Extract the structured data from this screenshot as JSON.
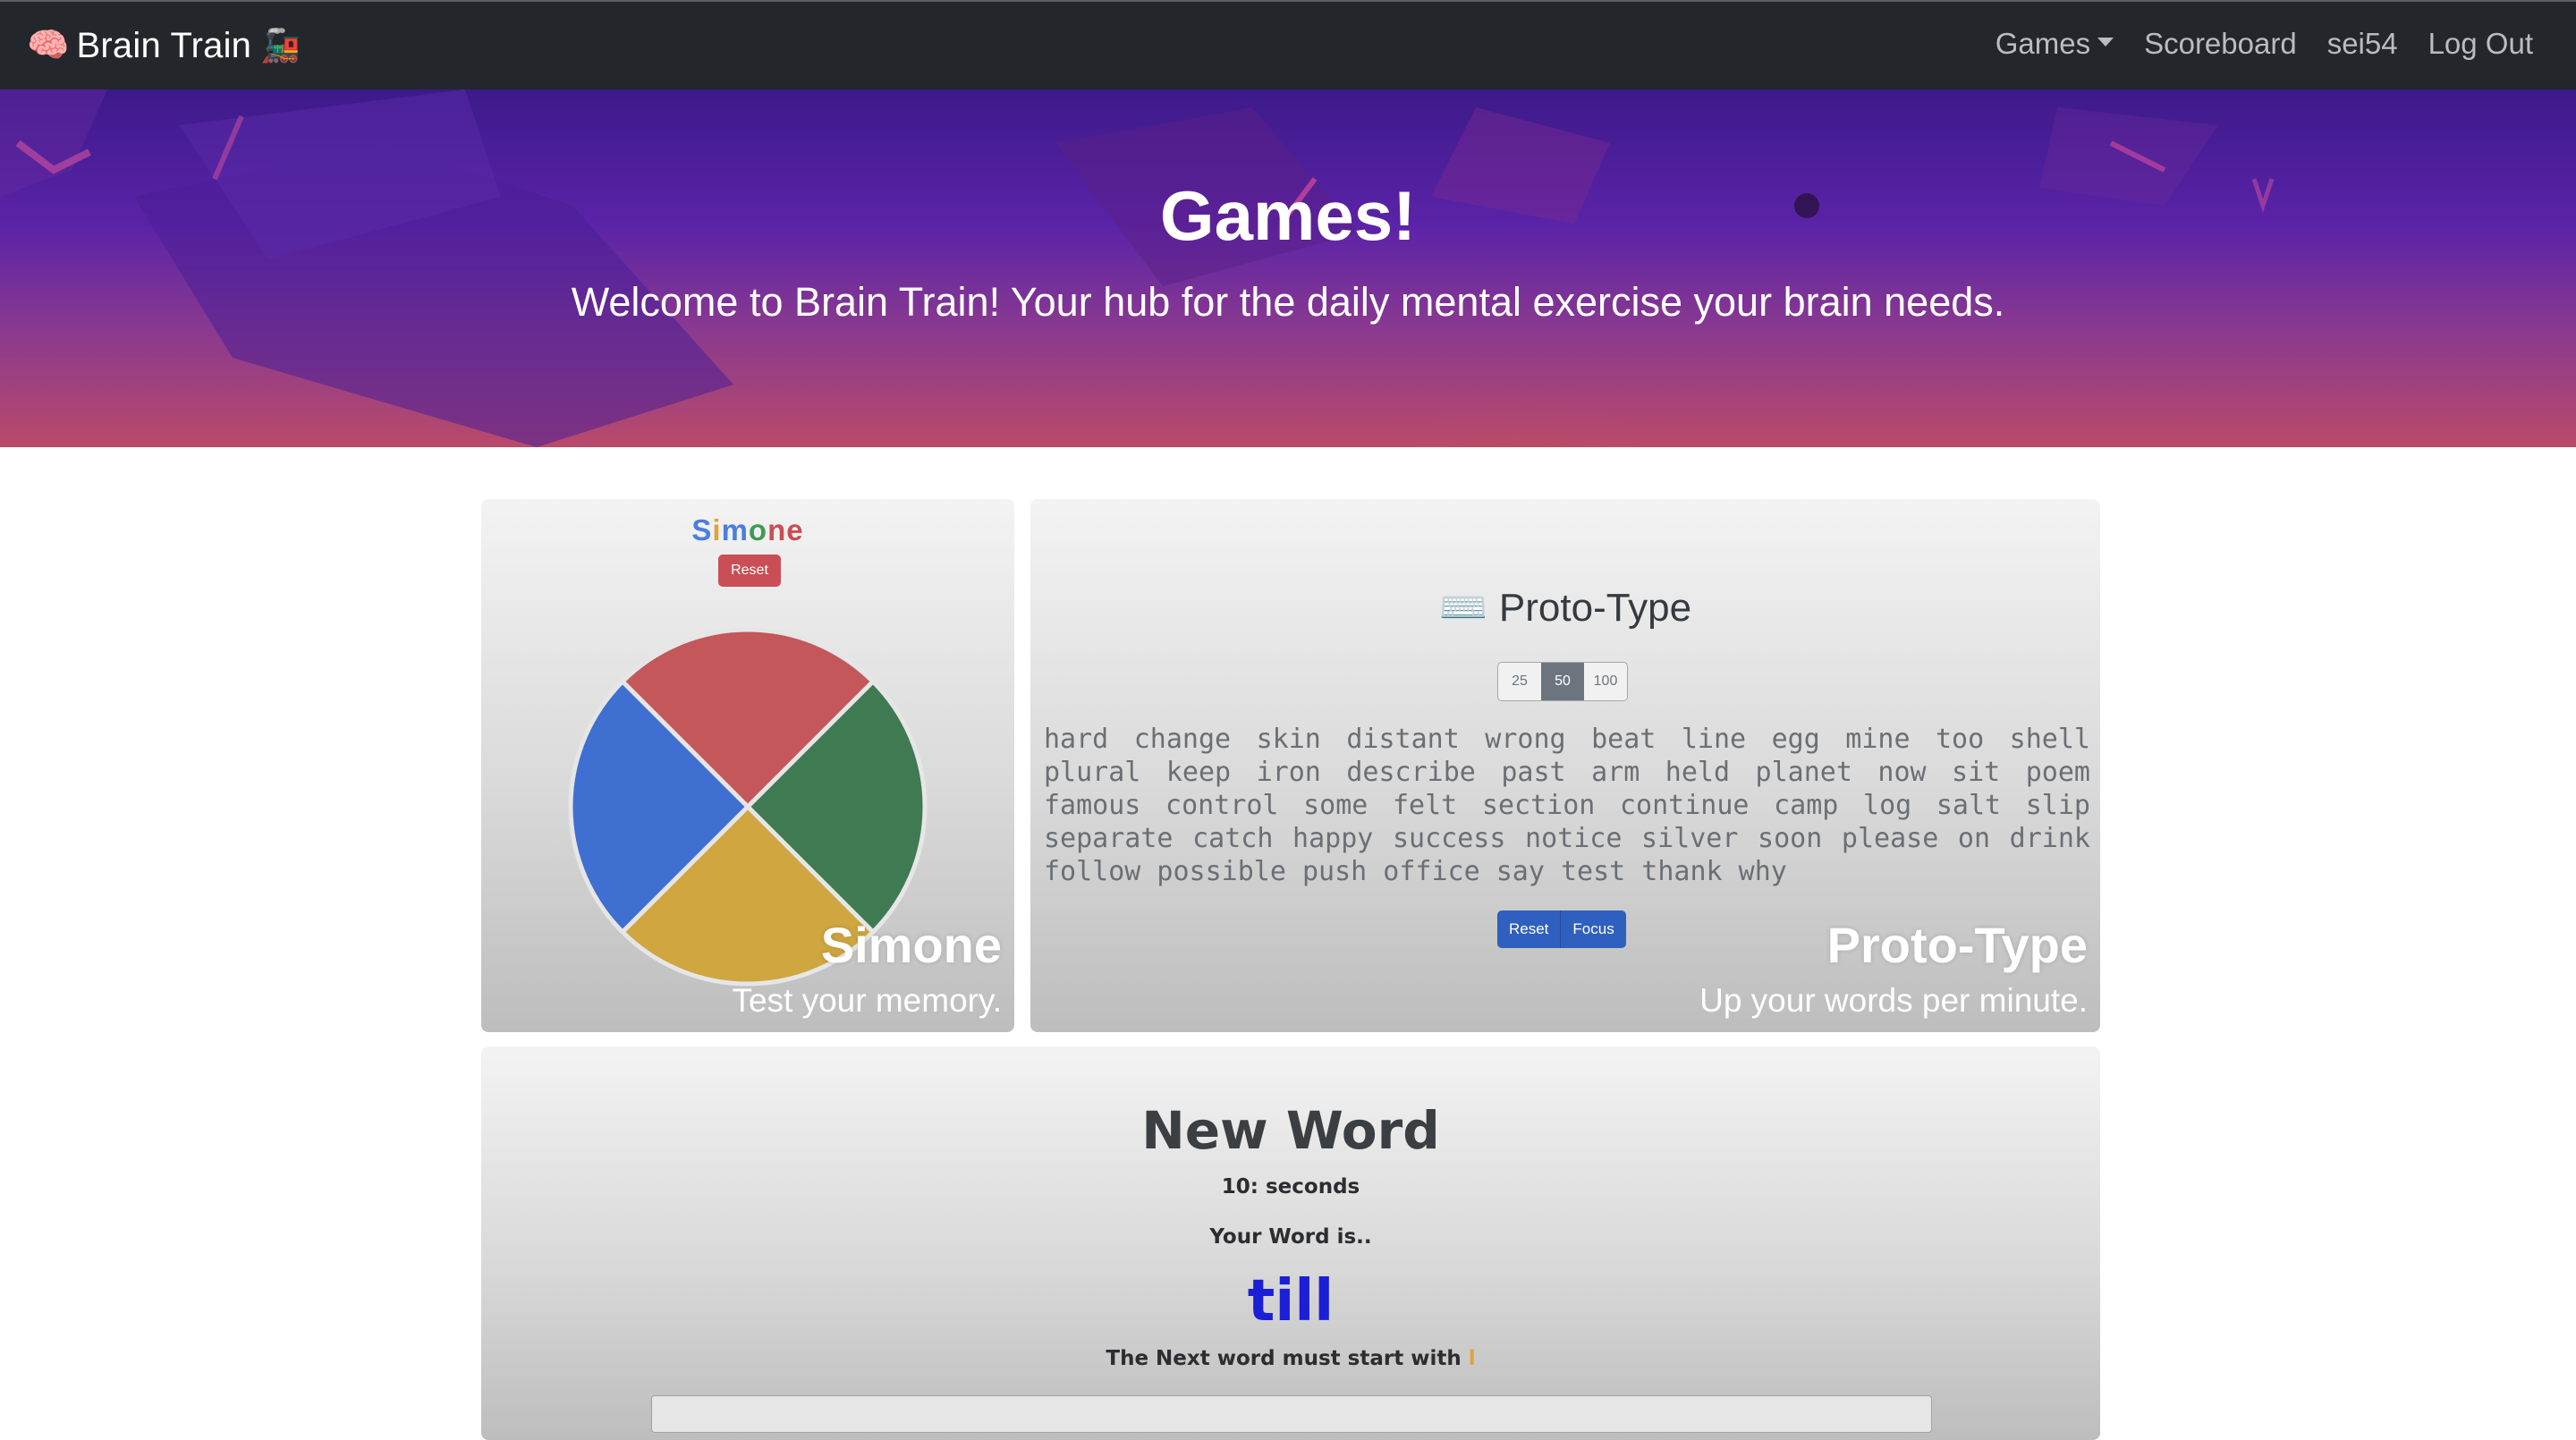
{
  "navbar": {
    "brand": "Brain Train",
    "brand_emoji_left": "🧠",
    "brand_emoji_right": "🚂",
    "links": {
      "games": "Games",
      "scoreboard": "Scoreboard",
      "user": "sei54",
      "logout": "Log Out"
    }
  },
  "hero": {
    "title": "Games!",
    "subtitle": "Welcome to Brain Train! Your hub for the daily mental exercise your brain needs."
  },
  "simone_card": {
    "title_letters": [
      "S",
      "i",
      "m",
      "o",
      "n",
      "e"
    ],
    "title_colors": [
      "#4a7ee0",
      "#e0a23a",
      "#4a7ee0",
      "#3f9a55",
      "#c94e56",
      "#c94e56"
    ],
    "reset_label": "Reset",
    "overlay_title": "Simone",
    "overlay_subtitle": "Test your memory.",
    "wheel_colors": {
      "top": "#c4575a",
      "right": "#3f7a52",
      "bottom": "#cfa640",
      "left": "#3f6fd0"
    }
  },
  "proto_card": {
    "icon": "⌨️",
    "heading": "Proto-Type",
    "word_counts": [
      "25",
      "50",
      "100"
    ],
    "selected_count": "50",
    "words": "hard change skin distant wrong beat line egg mine too shell plural keep iron describe past arm held planet now sit poem famous control some felt section continue camp log salt slip separate catch happy success notice silver soon please on drink follow possible push office say test thank why",
    "reset_label": "Reset",
    "focus_label": "Focus",
    "overlay_title": "Proto-Type",
    "overlay_subtitle": "Up your words per minute."
  },
  "new_word_card": {
    "title": "New Word",
    "timer": "10: seconds",
    "prompt": "Your Word is..",
    "word": "till",
    "rule_text": "The Next word must start with ",
    "rule_letter": "l",
    "input_placeholder": ""
  }
}
